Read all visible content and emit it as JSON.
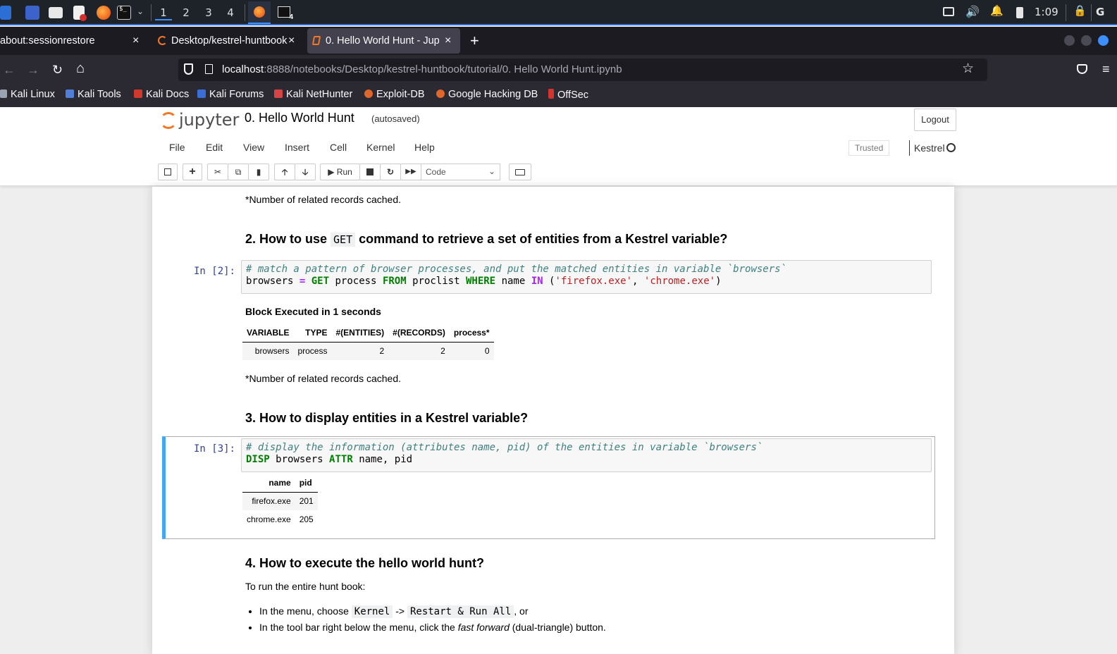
{
  "taskbar": {
    "workspaces": [
      "1",
      "2",
      "3",
      "4"
    ],
    "active_workspace": "1",
    "terminal_badge": "4",
    "clock": "1:09"
  },
  "browser": {
    "tabs": [
      {
        "label": "about:sessionrestore",
        "active": false
      },
      {
        "label": "Desktop/kestrel-huntbook",
        "active": false
      },
      {
        "label": "0. Hello World Hunt - Jup",
        "active": true
      }
    ],
    "new_tab": "+",
    "url_host": "localhost",
    "url_path": ":8888/notebooks/Desktop/kestrel-huntbook/tutorial/0. Hello World Hunt.ipynb",
    "bookmarks": [
      "Kali Linux",
      "Kali Tools",
      "Kali Docs",
      "Kali Forums",
      "Kali NetHunter",
      "Exploit-DB",
      "Google Hacking DB",
      "OffSec"
    ]
  },
  "jupyter": {
    "logo_text": "jupyter",
    "notebook_name": "0. Hello World Hunt",
    "autosave": "(autosaved)",
    "logout": "Logout",
    "menu": [
      "File",
      "Edit",
      "View",
      "Insert",
      "Cell",
      "Kernel",
      "Help"
    ],
    "trusted": "Trusted",
    "kernel": "Kestrel",
    "run_label": "Run",
    "cell_type": "Code"
  },
  "notebook": {
    "cached_note_1": "*Number of related records cached.",
    "h2_pre": "2. How to use",
    "h2_code": "GET",
    "h2_post": "command to retrieve a set of entities from a Kestrel variable?",
    "cell2_prompt": "In [2]:",
    "cell2_line1": "# match a pattern of browser processes, and put the matched entities in variable `browsers`",
    "cell2_line2": {
      "var": "browsers",
      "eq": "=",
      "get": "GET",
      "entity": "process",
      "from": "FROM",
      "src": "proclist",
      "where": "WHERE",
      "attr": "name",
      "in": "IN",
      "open": "(",
      "s1": "'firefox.exe'",
      "comma": ",",
      "s2": "'chrome.exe'",
      "close": ")"
    },
    "block_executed": "Block Executed in 1 seconds",
    "summary_table": {
      "headers": [
        "VARIABLE",
        "TYPE",
        "#(ENTITIES)",
        "#(RECORDS)",
        "process*"
      ],
      "rows": [
        [
          "browsers",
          "process",
          "2",
          "2",
          "0"
        ]
      ]
    },
    "cached_note_2": "*Number of related records cached.",
    "h3": "3. How to display entities in a Kestrel variable?",
    "cell3_prompt": "In [3]:",
    "cell3_line1": "# display the information (attributes name, pid) of the entities in variable `browsers`",
    "cell3_line2": {
      "disp": "DISP",
      "var": "browsers",
      "attr_kw": "ATTR",
      "attrs": "name, pid"
    },
    "disp_table": {
      "headers": [
        "name",
        "pid"
      ],
      "rows": [
        [
          "firefox.exe",
          "201"
        ],
        [
          "chrome.exe",
          "205"
        ]
      ]
    },
    "h4": "4. How to execute the hello world hunt?",
    "run_intro": "To run the entire hunt book:",
    "bullet1_pre": "In the menu, choose",
    "bullet1_code1": "Kernel",
    "bullet1_arrow": "->",
    "bullet1_code2": "Restart & Run All",
    "bullet1_post": ", or",
    "bullet2_pre": "In the tool bar right below the menu, click the",
    "bullet2_em": "fast forward",
    "bullet2_post": "(dual-triangle) button."
  }
}
